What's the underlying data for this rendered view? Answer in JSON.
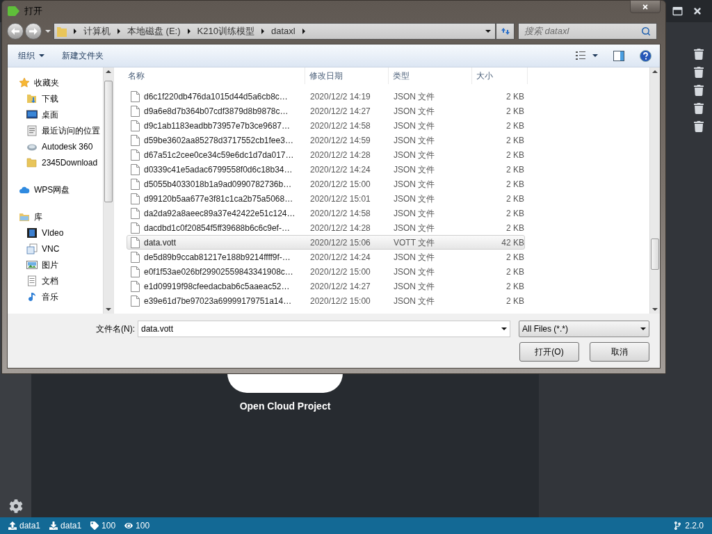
{
  "app": {
    "cloud_label": "Open Cloud Project",
    "status_bar": {
      "items": [
        {
          "kind": "upload",
          "text": "data1"
        },
        {
          "kind": "download",
          "text": "data1"
        },
        {
          "kind": "tag",
          "text": "100"
        },
        {
          "kind": "eye",
          "text": "100"
        }
      ],
      "version": "2.2.0"
    }
  },
  "dialog": {
    "title": "打开",
    "breadcrumb": [
      "计算机",
      "本地磁盘 (E:)",
      "K210训练模型",
      "dataxl"
    ],
    "search": {
      "placeholder": "搜索 dataxl"
    },
    "toolbar": [
      {
        "kind": "menu",
        "label": "组织"
      },
      {
        "kind": "button",
        "label": "新建文件夹"
      }
    ],
    "nav": [
      {
        "kind": "star",
        "label": "收藏夹",
        "children": [
          {
            "kind": "download",
            "label": "下载"
          },
          {
            "kind": "desktop",
            "label": "桌面"
          },
          {
            "kind": "recent",
            "label": "最近访问的位置"
          },
          {
            "kind": "autodesk",
            "label": "Autodesk 360"
          },
          {
            "kind": "folder",
            "label": "2345Download"
          }
        ]
      },
      {
        "kind": "cloud",
        "label": "WPS网盘"
      },
      {
        "kind": "library",
        "label": "库",
        "children": [
          {
            "kind": "video",
            "label": "VIdeo"
          },
          {
            "kind": "vnc",
            "label": "VNC"
          },
          {
            "kind": "pictures",
            "label": "图片"
          },
          {
            "kind": "documents",
            "label": "文档"
          },
          {
            "kind": "music",
            "label": "音乐"
          }
        ]
      }
    ],
    "columns": [
      "名称",
      "修改日期",
      "类型",
      "大小"
    ],
    "files": [
      {
        "name": "d6c1f220db476da1015d44d5a6cb8c…",
        "date": "2020/12/2 14:19",
        "type": "JSON 文件",
        "size": "2 KB",
        "selected": false
      },
      {
        "name": "d9a6e8d7b364b07cdf3879d8b9878c…",
        "date": "2020/12/2 14:27",
        "type": "JSON 文件",
        "size": "2 KB",
        "selected": false
      },
      {
        "name": "d9c1ab1183eadbb73957e7b3ce9687…",
        "date": "2020/12/2 14:58",
        "type": "JSON 文件",
        "size": "2 KB",
        "selected": false
      },
      {
        "name": "d59be3602aa85278d3717552cb1fee3…",
        "date": "2020/12/2 14:59",
        "type": "JSON 文件",
        "size": "2 KB",
        "selected": false
      },
      {
        "name": "d67a51c2cee0ce34c59e6dc1d7da017…",
        "date": "2020/12/2 14:28",
        "type": "JSON 文件",
        "size": "2 KB",
        "selected": false
      },
      {
        "name": "d0339c41e5adac6799558f0d6c18b34…",
        "date": "2020/12/2 14:24",
        "type": "JSON 文件",
        "size": "2 KB",
        "selected": false
      },
      {
        "name": "d5055b4033018b1a9ad0990782736b…",
        "date": "2020/12/2 15:00",
        "type": "JSON 文件",
        "size": "2 KB",
        "selected": false
      },
      {
        "name": "d99120b5aa677e3f81c1ca2b75a5068…",
        "date": "2020/12/2 15:01",
        "type": "JSON 文件",
        "size": "2 KB",
        "selected": false
      },
      {
        "name": "da2da92a8aeec89a37e42422e51c124…",
        "date": "2020/12/2 14:58",
        "type": "JSON 文件",
        "size": "2 KB",
        "selected": false
      },
      {
        "name": "dacdbd1c0f20854f5ff39688b6c6c9ef-…",
        "date": "2020/12/2 14:28",
        "type": "JSON 文件",
        "size": "2 KB",
        "selected": false
      },
      {
        "name": "data.vott",
        "date": "2020/12/2 15:06",
        "type": "VOTT 文件",
        "size": "42 KB",
        "selected": true
      },
      {
        "name": "de5d89b9ccab81217e188b9214ffff9f-…",
        "date": "2020/12/2 14:24",
        "type": "JSON 文件",
        "size": "2 KB",
        "selected": false
      },
      {
        "name": "e0f1f53ae026bf29902559843341908c…",
        "date": "2020/12/2 15:00",
        "type": "JSON 文件",
        "size": "2 KB",
        "selected": false
      },
      {
        "name": "e1d09919f98cfeedacbab6c5aaeac52…",
        "date": "2020/12/2 14:27",
        "type": "JSON 文件",
        "size": "2 KB",
        "selected": false
      },
      {
        "name": "e39e61d7be97023a69999179751a14…",
        "date": "2020/12/2 15:00",
        "type": "JSON 文件",
        "size": "2 KB",
        "selected": false
      }
    ],
    "filename": {
      "label": "文件名(N):",
      "value": "data.vott"
    },
    "filter": "All Files (*.*)",
    "buttons": [
      "打开(O)",
      "取消"
    ]
  }
}
